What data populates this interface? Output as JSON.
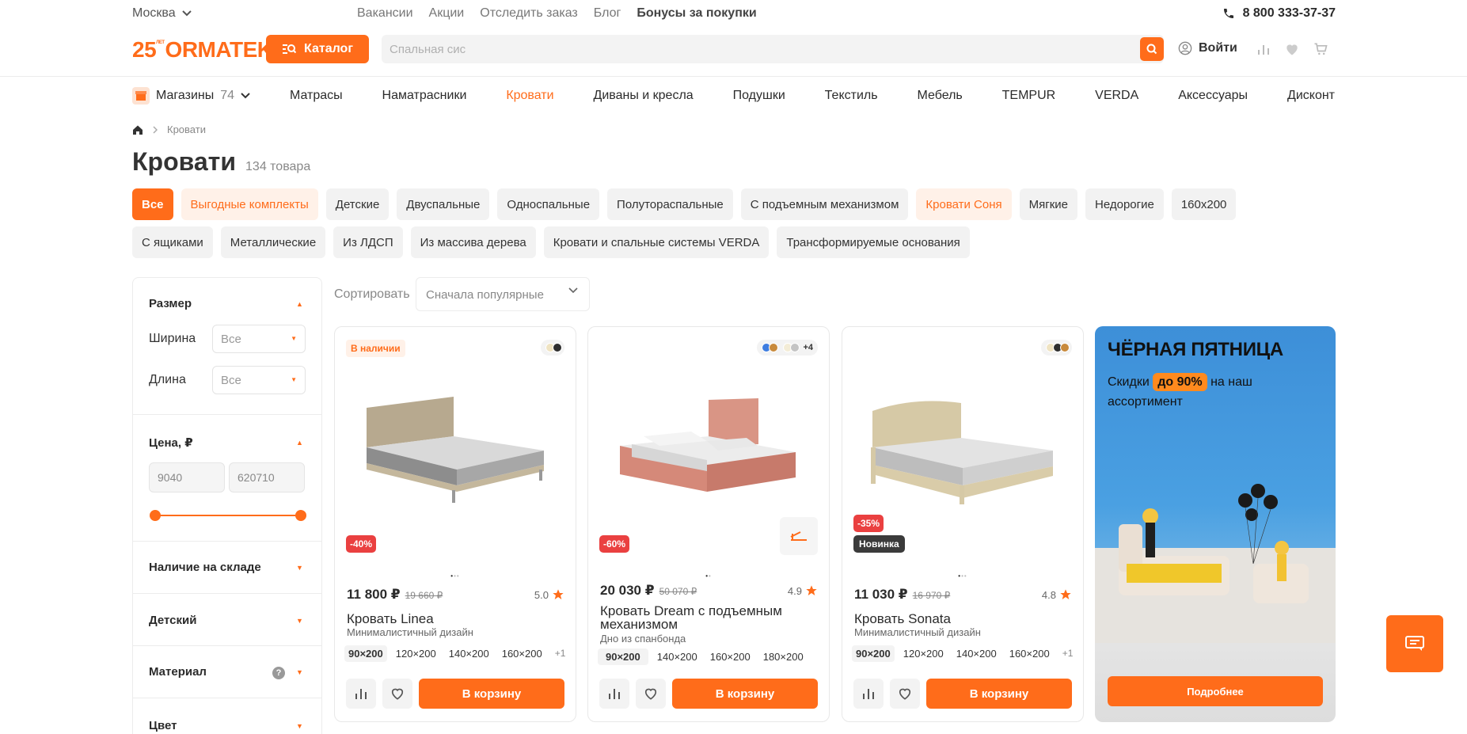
{
  "topbar": {
    "city": "Москва",
    "links": [
      "Вакансии",
      "Акции",
      "Отследить заказ",
      "Блог"
    ],
    "bonus": "Бонусы за покупки",
    "phone": "8 800 333-37-37"
  },
  "header": {
    "logo_num": "25",
    "logo_ann": "ЛЕТ",
    "logo_text": "ORMATEK",
    "catalog": "Каталог",
    "search_placeholder": "Спальная сис",
    "login": "Войти"
  },
  "nav": {
    "stores": "Магазины",
    "stores_count": "74",
    "items": [
      "Матрасы",
      "Наматрасники",
      "Кровати",
      "Диваны и кресла",
      "Подушки",
      "Текстиль",
      "Мебель",
      "TEMPUR",
      "VERDA",
      "Аксессуары",
      "Дисконт"
    ],
    "active": "Кровати"
  },
  "breadcrumb": {
    "current": "Кровати"
  },
  "page": {
    "title": "Кровати",
    "count": "134 товара"
  },
  "chips_row1": [
    "Все",
    "Выгодные комплекты",
    "Детские",
    "Двуспальные",
    "Односпальные",
    "Полутораспальные",
    "С подъемным механизмом",
    "Кровати Соня",
    "Мягкие",
    "Недорогие",
    "160x200"
  ],
  "chips_row2": [
    "С ящиками",
    "Металлические",
    "Из ЛДСП",
    "Из массива дерева",
    "Кровати и спальные системы VERDA",
    "Трансформируемые основания"
  ],
  "filters": {
    "size_title": "Размер",
    "width_label": "Ширина",
    "length_label": "Длина",
    "all": "Все",
    "price_title": "Цена, ₽",
    "price_min": "9040",
    "price_max": "620710",
    "price_range_fraction": [
      0,
      1
    ],
    "stock_title": "Наличие на складе",
    "kids_title": "Детский",
    "material_title": "Материал",
    "help": "?",
    "color_title": "Цвет"
  },
  "sort": {
    "label": "Сортировать",
    "value": "Сначала популярные"
  },
  "products": [
    {
      "stock": "В наличии",
      "colors": [
        "#efe3c2",
        "#2e2e2e"
      ],
      "more_colors": "",
      "discount": "-40%",
      "new": "",
      "price": "11 800 ₽",
      "old_price": "19 660 ₽",
      "rating": "5.0",
      "name": "Кровать Linea",
      "desc": "Минималистичный дизайн",
      "sizes": [
        "90×200",
        "120×200",
        "140×200",
        "160×200"
      ],
      "more_sizes": "+1",
      "cart": "В корзину"
    },
    {
      "stock": "",
      "colors": [
        "#3e7de0",
        "#c88a3c",
        "#f3ecd6",
        "#c4c4c4"
      ],
      "more_colors": "+4",
      "discount": "-60%",
      "new": "",
      "price": "20 030 ₽",
      "old_price": "50 070 ₽",
      "rating": "4.9",
      "name": "Кровать Dream с подъемным механизмом",
      "desc": "Дно из спанбонда",
      "sizes": [
        "90×200",
        "140×200",
        "160×200",
        "180×200"
      ],
      "more_sizes": "",
      "cart": "В корзину"
    },
    {
      "stock": "",
      "colors": [
        "#efe3c2",
        "#2e2e2e",
        "#c88a3c"
      ],
      "more_colors": "",
      "discount": "-35%",
      "new": "Новинка",
      "price": "11 030 ₽",
      "old_price": "16 970 ₽",
      "rating": "4.8",
      "name": "Кровать Sonata",
      "desc": "Минималистичный дизайн",
      "sizes": [
        "90×200",
        "120×200",
        "140×200",
        "160×200"
      ],
      "more_sizes": "+1",
      "cart": "В корзину"
    }
  ],
  "promo": {
    "title": "ЧЁРНАЯ ПЯТНИЦА",
    "sub_before": "Скидки",
    "sub_pill": "до 90%",
    "sub_after": "на наш ассортимент",
    "button": "Подробнее"
  },
  "colors": {
    "accent": "#ff6c1a",
    "discount": "#ea4040"
  }
}
